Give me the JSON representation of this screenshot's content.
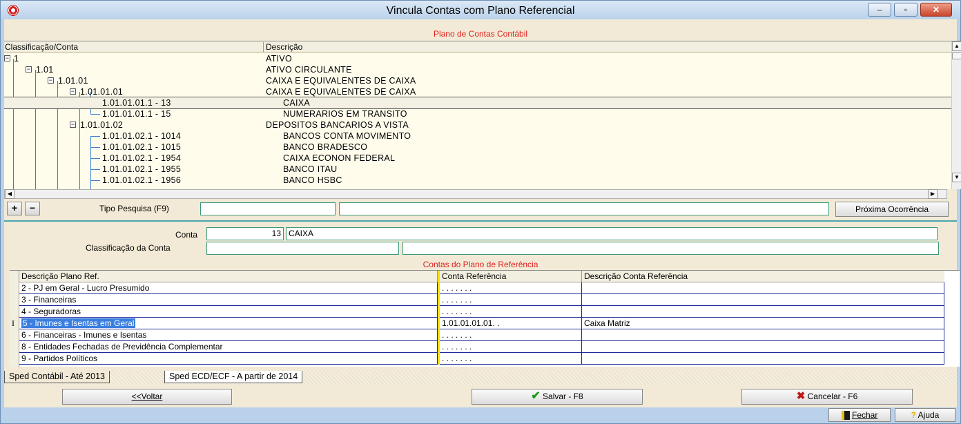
{
  "window": {
    "title": "Vincula Contas com Plano Referencial",
    "minimize_glyph": "‒",
    "maximize_glyph": "▫",
    "close_glyph": "✕"
  },
  "plano_contas": {
    "section_title": "Plano de Contas Contábil",
    "col_classificacao": "Classificação/Conta",
    "col_descricao": "Descrição",
    "rows": [
      {
        "code": "1",
        "desc": "ATIVO"
      },
      {
        "code": "1.01",
        "desc": "ATIVO CIRCULANTE"
      },
      {
        "code": "1.01.01",
        "desc": "CAIXA E EQUIVALENTES DE CAIXA"
      },
      {
        "code": "1.01.01.01",
        "desc": "CAIXA E EQUIVALENTES DE CAIXA"
      },
      {
        "code": "1.01.01.01.1 - 13",
        "desc": "CAIXA"
      },
      {
        "code": "1.01.01.01.1 - 15",
        "desc": "NUMERARIOS EM TRANSITO"
      },
      {
        "code": "1.01.01.02",
        "desc": "DEPOSITOS BANCARIOS A VISTA"
      },
      {
        "code": "1.01.01.02.1 - 1014",
        "desc": "BANCOS CONTA MOVIMENTO"
      },
      {
        "code": "1.01.01.02.1 - 1015",
        "desc": "BANCO BRADESCO"
      },
      {
        "code": "1.01.01.02.1 - 1954",
        "desc": "CAIXA ECONON FEDERAL"
      },
      {
        "code": "1.01.01.02.1 - 1955",
        "desc": "BANCO ITAU"
      },
      {
        "code": "1.01.01.02.1 - 1956",
        "desc": "BANCO HSBC"
      }
    ]
  },
  "search": {
    "plus_label": "+",
    "minus_label": "−",
    "tipo_pesquisa_label": "Tipo Pesquisa (F9)",
    "tipo_value": "",
    "text_value": "",
    "next_button": "Próxima Ocorrência"
  },
  "conta": {
    "conta_label": "Conta",
    "conta_number": "13",
    "conta_name": "CAIXA",
    "classificacao_label": "Classificação da Conta",
    "classificacao_value": "",
    "classificacao_desc": ""
  },
  "referencia": {
    "section_title": "Contas do Plano de Referência",
    "col_descricao_plano": "Descrição Plano Ref.",
    "col_conta_ref": "Conta Referência",
    "col_desc_conta_ref": "Descrição Conta Referência",
    "cursor_glyph": "I",
    "rows": [
      {
        "plano": "2 - PJ em Geral - Lucro Presumido",
        "conta": ". . . . . . .",
        "desc": ""
      },
      {
        "plano": "3 - Financeiras",
        "conta": ". . . . . . .",
        "desc": ""
      },
      {
        "plano": "4 - Seguradoras",
        "conta": ". . . . . . .",
        "desc": ""
      },
      {
        "plano": "5 - Imunes e Isentas em Geral",
        "conta": "1.01.01.01.01. .",
        "desc": "Caixa Matriz"
      },
      {
        "plano": "6 - Financeiras - Imunes e Isentas",
        "conta": ". . . . . . .",
        "desc": ""
      },
      {
        "plano": "8 - Entidades Fechadas de Previdência Complementar",
        "conta": ". . . . . . .",
        "desc": ""
      },
      {
        "plano": "9 - Partidos Políticos",
        "conta": ". . . . . . .",
        "desc": ""
      }
    ]
  },
  "tabs": [
    {
      "label": "Sped Contábil - Até 2013"
    },
    {
      "label": "Sped ECD/ECF - A partir de 2014"
    }
  ],
  "actions": {
    "voltar": "<<Voltar",
    "salvar": "Salvar - F8",
    "cancelar": "Cancelar - F6",
    "fechar": "Fechar",
    "ajuda": "Ajuda"
  },
  "colors": {
    "title_text": "#000000",
    "section_title": "#e02020",
    "tree_line": "#3b7fd0",
    "grid_line": "#1e2a9a",
    "selection": "#3a7fe0",
    "accent_yellow": "#f5e20a"
  }
}
